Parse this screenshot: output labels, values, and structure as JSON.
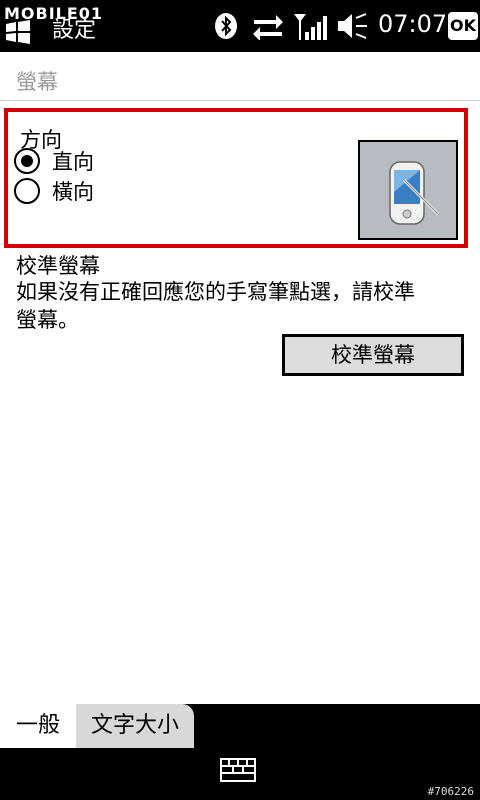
{
  "statusbar": {
    "brand": "MOBILE01",
    "app_title": "設定",
    "time": "07:07",
    "ok": "OK",
    "icons": [
      "bluetooth-icon",
      "sync-arrows-icon",
      "signal-icon",
      "speaker-icon"
    ]
  },
  "section": {
    "title": "螢幕"
  },
  "orientation": {
    "label": "方向",
    "options": [
      {
        "label": "直向",
        "selected": true
      },
      {
        "label": "橫向",
        "selected": false
      }
    ]
  },
  "calibration": {
    "title": "校準螢幕",
    "description": "如果沒有正確回應您的手寫筆點選，請校準螢幕。",
    "button_label": "校準螢幕"
  },
  "tabs": [
    {
      "label": "一般",
      "active": true
    },
    {
      "label": "文字大小",
      "active": false
    }
  ],
  "watermark": "#706226",
  "colors": {
    "highlight_border": "#d40000",
    "preview_bg": "#b8bcc0"
  }
}
